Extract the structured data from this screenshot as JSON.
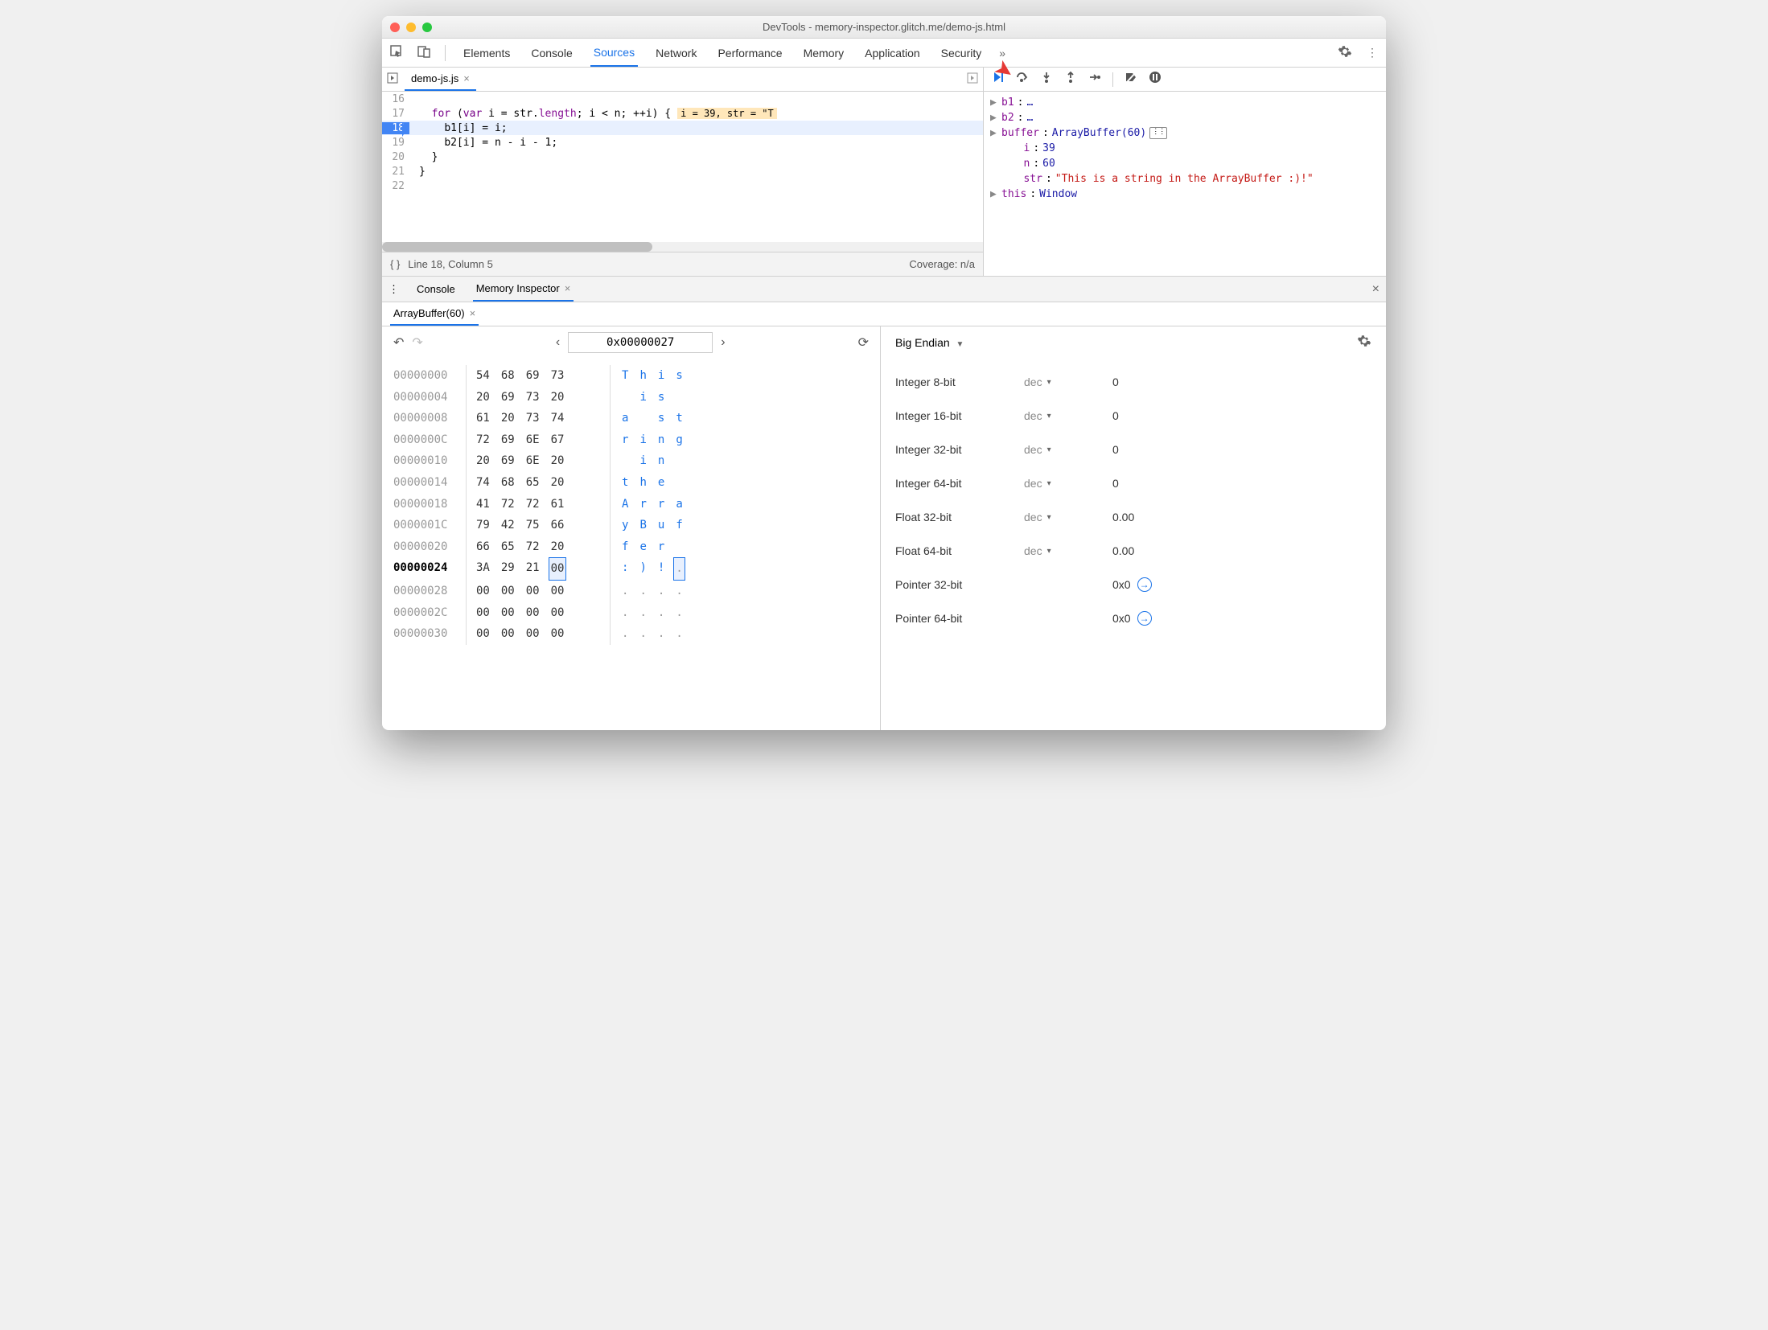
{
  "window": {
    "title": "DevTools - memory-inspector.glitch.me/demo-js.html"
  },
  "tabs": [
    "Elements",
    "Console",
    "Sources",
    "Network",
    "Performance",
    "Memory",
    "Application",
    "Security"
  ],
  "activeTab": "Sources",
  "fileTab": "demo-js.js",
  "code": {
    "lines": [
      {
        "n": 16,
        "text": ""
      },
      {
        "n": 17,
        "text": "  for (var i = str.length; i < n; ++i) {",
        "inline": "i = 39, str = \"T"
      },
      {
        "n": 18,
        "text": "    b1[i] = i;",
        "bp": true,
        "exec": true
      },
      {
        "n": 19,
        "text": "    b2[i] = n - i - 1;"
      },
      {
        "n": 20,
        "text": "  }"
      },
      {
        "n": 21,
        "text": "}"
      },
      {
        "n": 22,
        "text": ""
      }
    ]
  },
  "status": {
    "linecol": "Line 18, Column 5",
    "coverage": "Coverage: n/a"
  },
  "scope": [
    {
      "name": "b1",
      "value": "…",
      "expand": true
    },
    {
      "name": "b2",
      "value": "…",
      "expand": true
    },
    {
      "name": "buffer",
      "value": "ArrayBuffer(60)",
      "expand": true,
      "mem": true
    },
    {
      "name": "i",
      "value": "39",
      "indent": true
    },
    {
      "name": "n",
      "value": "60",
      "indent": true
    },
    {
      "name": "str",
      "value": "\"This is a string in the ArrayBuffer :)!\"",
      "str": true,
      "indent": true
    },
    {
      "name": "this",
      "value": "Window",
      "expand": true
    }
  ],
  "drawer": {
    "tabs": [
      "Console",
      "Memory Inspector"
    ],
    "active": "Memory Inspector"
  },
  "memInspector": {
    "tab": "ArrayBuffer(60)",
    "address": "0x00000027",
    "rows": [
      {
        "addr": "00000000",
        "bytes": [
          "54",
          "68",
          "69",
          "73"
        ],
        "ascii": [
          "T",
          "h",
          "i",
          "s"
        ]
      },
      {
        "addr": "00000004",
        "bytes": [
          "20",
          "69",
          "73",
          "20"
        ],
        "ascii": [
          " ",
          "i",
          "s",
          " "
        ]
      },
      {
        "addr": "00000008",
        "bytes": [
          "61",
          "20",
          "73",
          "74"
        ],
        "ascii": [
          "a",
          " ",
          "s",
          "t"
        ]
      },
      {
        "addr": "0000000C",
        "bytes": [
          "72",
          "69",
          "6E",
          "67"
        ],
        "ascii": [
          "r",
          "i",
          "n",
          "g"
        ]
      },
      {
        "addr": "00000010",
        "bytes": [
          "20",
          "69",
          "6E",
          "20"
        ],
        "ascii": [
          " ",
          "i",
          "n",
          " "
        ]
      },
      {
        "addr": "00000014",
        "bytes": [
          "74",
          "68",
          "65",
          "20"
        ],
        "ascii": [
          "t",
          "h",
          "e",
          " "
        ]
      },
      {
        "addr": "00000018",
        "bytes": [
          "41",
          "72",
          "72",
          "61"
        ],
        "ascii": [
          "A",
          "r",
          "r",
          "a"
        ]
      },
      {
        "addr": "0000001C",
        "bytes": [
          "79",
          "42",
          "75",
          "66"
        ],
        "ascii": [
          "y",
          "B",
          "u",
          "f"
        ]
      },
      {
        "addr": "00000020",
        "bytes": [
          "66",
          "65",
          "72",
          "20"
        ],
        "ascii": [
          "f",
          "e",
          "r",
          " "
        ]
      },
      {
        "addr": "00000024",
        "bytes": [
          "3A",
          "29",
          "21",
          "00"
        ],
        "ascii": [
          ":",
          ")",
          "!",
          "."
        ],
        "hl": true,
        "sel": 3
      },
      {
        "addr": "00000028",
        "bytes": [
          "00",
          "00",
          "00",
          "00"
        ],
        "ascii": [
          ".",
          ".",
          ".",
          "."
        ]
      },
      {
        "addr": "0000002C",
        "bytes": [
          "00",
          "00",
          "00",
          "00"
        ],
        "ascii": [
          ".",
          ".",
          ".",
          "."
        ]
      },
      {
        "addr": "00000030",
        "bytes": [
          "00",
          "00",
          "00",
          "00"
        ],
        "ascii": [
          ".",
          ".",
          ".",
          "."
        ]
      }
    ],
    "endian": "Big Endian",
    "values": [
      {
        "label": "Integer 8-bit",
        "mode": "dec",
        "value": "0"
      },
      {
        "label": "Integer 16-bit",
        "mode": "dec",
        "value": "0"
      },
      {
        "label": "Integer 32-bit",
        "mode": "dec",
        "value": "0"
      },
      {
        "label": "Integer 64-bit",
        "mode": "dec",
        "value": "0"
      },
      {
        "label": "Float 32-bit",
        "mode": "dec",
        "value": "0.00"
      },
      {
        "label": "Float 64-bit",
        "mode": "dec",
        "value": "0.00"
      },
      {
        "label": "Pointer 32-bit",
        "mode": "",
        "value": "0x0",
        "jump": true
      },
      {
        "label": "Pointer 64-bit",
        "mode": "",
        "value": "0x0",
        "jump": true
      }
    ]
  }
}
